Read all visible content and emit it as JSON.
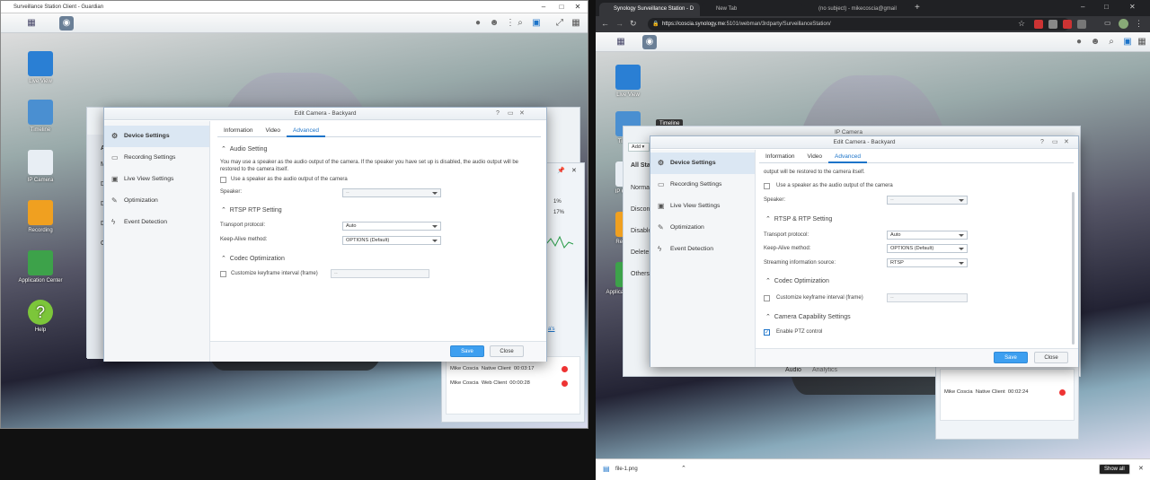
{
  "left_window": {
    "title": "Surveillance Station Client - Guardian",
    "desktop_icons": [
      {
        "label": "Live View"
      },
      {
        "label": "Timeline"
      },
      {
        "label": "IP Camera"
      },
      {
        "label": "Recording"
      },
      {
        "label": "Application Center"
      },
      {
        "label": "Help"
      }
    ],
    "bg_panel": {
      "sidebar": [
        "A",
        "M",
        "D",
        "D",
        "D",
        "O"
      ],
      "pct1": "1%",
      "pct2": "17%",
      "link": "a's",
      "sessions": [
        {
          "user": "Mike Coscia",
          "client": "Native Client",
          "time": "00:03:17"
        },
        {
          "user": "Mike Coscia",
          "client": "Web Client",
          "time": "00:00:28"
        }
      ]
    },
    "dialog": {
      "title": "Edit Camera - Backyard",
      "sidebar": [
        {
          "label": "Device Settings",
          "icon": "gear-icon"
        },
        {
          "label": "Recording Settings",
          "icon": "record-icon"
        },
        {
          "label": "Live View Settings",
          "icon": "monitor-icon"
        },
        {
          "label": "Optimization",
          "icon": "wrench-icon"
        },
        {
          "label": "Event Detection",
          "icon": "lightning-icon"
        }
      ],
      "tabs": [
        "Information",
        "Video",
        "Advanced"
      ],
      "audio_heading": "Audio Setting",
      "audio_desc": "You may use a speaker as the audio output of the camera. If the speaker you have set up is disabled, the audio output will be restored to the camera itself.",
      "use_speaker": "Use a speaker as the audio output of the camera",
      "speaker_label": "Speaker:",
      "speaker_value": "--",
      "rtsp_heading": "RTSP  RTP Setting",
      "transport_label": "Transport protocol:",
      "transport_value": "Auto",
      "keepalive_label": "Keep-Alive method:",
      "keepalive_value": "OPTIONS (Default)",
      "codec_heading": "Codec Optimization",
      "keyframe_label": "Customize keyframe interval (frame)",
      "keyframe_value": "--",
      "save": "Save",
      "close": "Close"
    }
  },
  "right_window": {
    "tabs": [
      {
        "label": "Synology Surveillance Station - D"
      },
      {
        "label": "New Tab"
      },
      {
        "label": "(no subject) - mikecoscia@gmail"
      }
    ],
    "url_prefix": "https://coscia.synology.me",
    "url_rest": ":5101/webman/3rdparty/SurveillanceStation/",
    "desktop_icons": [
      {
        "label": "Live View"
      },
      {
        "label": "Timeline"
      },
      {
        "label": "IP Camera"
      },
      {
        "label": "Recording"
      },
      {
        "label": "Application Center"
      }
    ],
    "tooltip": "Timeline",
    "bg_window_title": "IP Camera",
    "add_label": "Add",
    "bg_sidebar": [
      "All Sta",
      "Norma",
      "Discon",
      "Disable",
      "Delete",
      "Others"
    ],
    "bg_tabs": [
      "Audio",
      "Analytics"
    ],
    "sessions": [
      {
        "user": "Mike Coscia",
        "client": "Native Client",
        "time": "00:02:24"
      }
    ],
    "dialog": {
      "title": "Edit Camera - Backyard",
      "sidebar": [
        {
          "label": "Device Settings"
        },
        {
          "label": "Recording Settings"
        },
        {
          "label": "Live View Settings"
        },
        {
          "label": "Optimization"
        },
        {
          "label": "Event Detection"
        }
      ],
      "tabs": [
        "Information",
        "Video",
        "Advanced"
      ],
      "restored_text": "output will be restored to the camera itself.",
      "use_speaker": "Use a speaker as the audio output of the camera",
      "speaker_label": "Speaker:",
      "speaker_value": "--",
      "rtsp_heading": "RTSP & RTP Setting",
      "transport_label": "Transport protocol:",
      "transport_value": "Auto",
      "keepalive_label": "Keep-Alive method:",
      "keepalive_value": "OPTIONS (Default)",
      "streaming_label": "Streaming information source:",
      "streaming_value": "RTSP",
      "codec_heading": "Codec Optimization",
      "keyframe_label": "Customize keyframe interval (frame)",
      "keyframe_value": "--",
      "capability_heading": "Camera Capability Settings",
      "ptz_label": "Enable PTZ control",
      "save": "Save",
      "close": "Close"
    },
    "download_file": "file-1.png",
    "show_all": "Show all"
  }
}
